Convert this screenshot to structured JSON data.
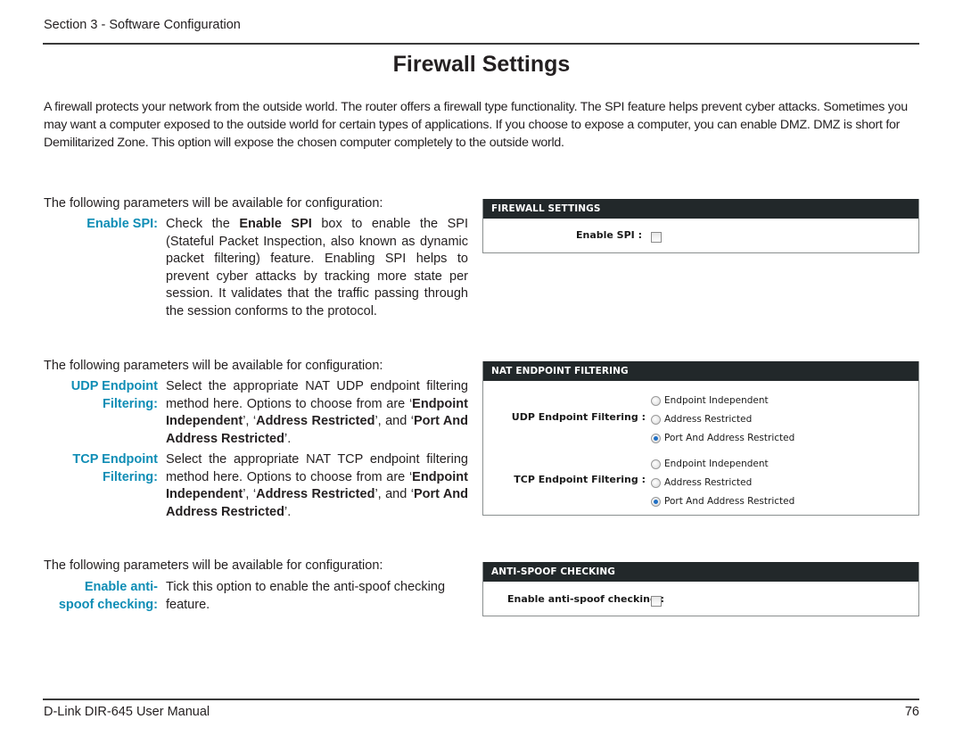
{
  "header": {
    "section": "Section 3 - Software Configuration"
  },
  "page": {
    "title": "Firewall Settings",
    "intro": "A firewall protects your network from the outside world. The router offers a firewall type functionality. The SPI feature helps prevent cyber attacks. Sometimes you may want a computer exposed to the outside world for certain types of applications. If you choose to expose a computer, you can enable DMZ. DMZ is short for Demilitarized Zone. This option will expose the chosen computer completely to the outside world."
  },
  "sections": [
    {
      "heading": "The following parameters will be available for configuration:",
      "params": [
        {
          "label": "Enable SPI:",
          "desc_pre": "Check the ",
          "desc_bold": "Enable SPI",
          "desc_post": " box to enable the SPI (Stateful Packet Inspection, also known as dynamic packet filtering) feature. Enabling SPI helps to prevent cyber attacks by tracking more state per session. It validates that the traffic passing through the session conforms to the protocol."
        }
      ]
    },
    {
      "heading": "The following parameters will be available for configuration:",
      "params": [
        {
          "label_line1": "UDP Endpoint",
          "label_line2": "Filtering:",
          "desc_pre": "Select the appropriate NAT UDP endpoint filtering method here. Options to choose from are ",
          "opt1": "Endpoint Independent",
          "opt2": "Address Restricted",
          "opt3": "Port And Address Restricted",
          "and": ", and "
        },
        {
          "label_line1": "TCP Endpoint",
          "label_line2": "Filtering:",
          "desc_pre": "Select the appropriate NAT TCP endpoint filtering method here. Options to choose from are ",
          "opt1": "Endpoint Independent",
          "opt2": "Address Restricted",
          "opt3": "Port And Address Restricted",
          "and": ", and "
        }
      ]
    },
    {
      "heading": "The following parameters will be available for configuration:",
      "params": [
        {
          "label_line1": "Enable anti-",
          "label_line2": "spoof checking:",
          "desc": "Tick this option to enable the anti-spoof checking feature."
        }
      ]
    }
  ],
  "panels": {
    "firewall": {
      "title": "FIREWALL SETTINGS",
      "enable_spi_label": "Enable SPI  :",
      "enable_spi_checked": false
    },
    "nat": {
      "title": "NAT ENDPOINT FILTERING",
      "udp_label": "UDP Endpoint Filtering  :",
      "tcp_label": "TCP Endpoint Filtering  :",
      "options": [
        "Endpoint Independent",
        "Address Restricted",
        "Port And Address Restricted"
      ],
      "udp_selected": "Port And Address Restricted",
      "tcp_selected": "Port And Address Restricted"
    },
    "antispoof": {
      "title": "ANTI-SPOOF CHECKING",
      "label": "Enable anti-spoof checking  :",
      "checked": false
    }
  },
  "colors": {
    "accent": "#0f8db5",
    "panel_header": "#22282a",
    "radio_selected": "#1f6fc4"
  },
  "footer": {
    "manual": "D-Link DIR-645 User Manual",
    "page_number": "76"
  }
}
